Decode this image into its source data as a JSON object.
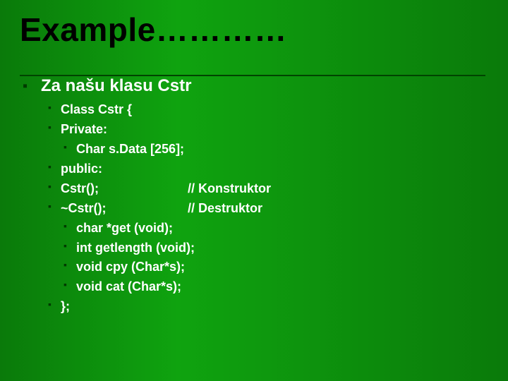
{
  "title": "Example…………",
  "heading": "Za našu klasu Cstr",
  "items": {
    "class_open": "Class Cstr {",
    "private": "Private:",
    "char_sdata": "Char  s.Data [256];",
    "public_": "public:",
    "ctor_left": "Cstr();",
    "ctor_right": "// Konstruktor",
    "dtor_left": "~Cstr();",
    "dtor_right": "// Destruktor",
    "get": "char *get (void);",
    "getlength": "int getlength (void);",
    "cpy": "void cpy (Char*s);",
    "cat": "void cat (Char*s);",
    "class_close": "};"
  }
}
